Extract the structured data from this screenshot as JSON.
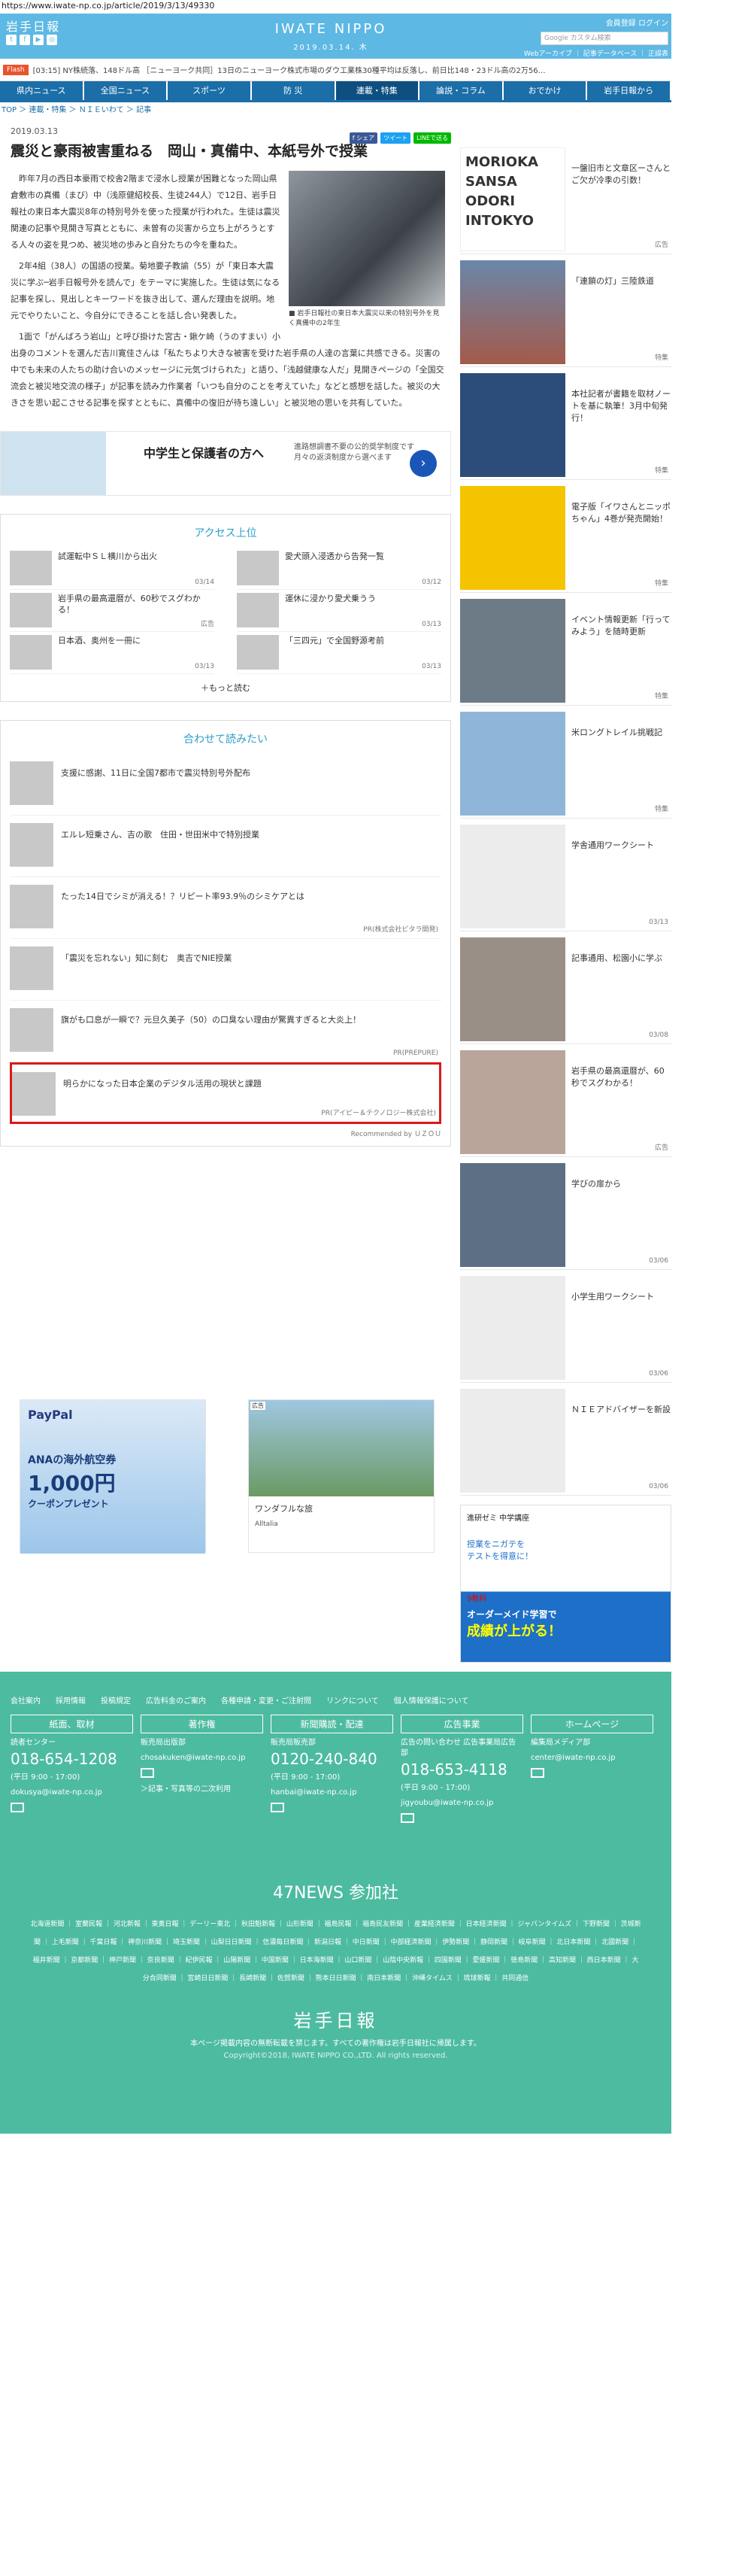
{
  "url": "https://www.iwate-np.co.jp/article/2019/3/13/49330",
  "header": {
    "logo_left": "岩手日報",
    "logo_center": "IWATE NIPPO",
    "date": "2019.03.14. 木",
    "links": "会員登録  ログイン",
    "search_placeholder": "Google カスタム検索",
    "sublinks": "Webアーカイブ ｜ 記事データベース ｜ 正誤表"
  },
  "flash": {
    "label": "Flash",
    "text": "[03:15] NY株続落、148ドル高 ［ニューヨーク共同］13日のニューヨーク株式市場のダウ工業株30種平均は反落し、前日比148・23ドル高の2万56…"
  },
  "nav": [
    "県内ニュース",
    "全国ニュース",
    "スポーツ",
    "防 災",
    "連載・特集",
    "論説・コラム",
    "おでかけ",
    "岩手日報から"
  ],
  "crumb": "TOP ＞ 連載・特集 ＞ ＮＩＥいわて ＞ 記事",
  "article": {
    "date": "2019.03.13",
    "share": [
      "f シェア",
      "ツイート",
      "LINEで送る"
    ],
    "title": "震災と豪雨被害重ねる　岡山・真備中、本紙号外で授業",
    "caption": "■ 岩手日報社の東日本大震災以来の特別号外を見く真備中の2年生",
    "paras": [
      "昨年7月の西日本豪雨で校舎2階まで浸水し授業が困難となった岡山県倉敷市の真備（まび）中（浅原健紹校長、生徒244人）で12日、岩手日報社の東日本大震災8年の特別号外を使った授業が行われた。生徒は震災関連の記事や見開き写真とともに、未曽有の災害から立ち上がろうとする人々の姿を見つめ、被災地の歩みと自分たちの今を重ねた。",
      "2年4組（38人）の国語の授業。菊地要子教諭（55）が「東日本大震災に学ぶ─岩手日報号外を読んで」をテーマに実施した。生徒は気になる記事を探し、見出しとキーワードを抜き出して、選んだ理由を説明。地元でやりたいこと、今自分にできることを話し合い発表した。",
      "1面で「がんばろう岩山」と呼び掛けた宮古・鍬ケ崎（うのすまい）小出身のコメントを選んだ吉川寛佳さんは「私たちより大きな被害を受けた岩手県の人達の言葉に共感できる。災害の中でも未来の人たちの助け合いのメッセージに元気づけられた」と語り、「浅越健康な人だ」見開きページの「全国交流会と被災地交流の様子」が記事を読み力作業者「いつも自分のことを考えていた」などと感想を話した。被災の大きさを思い起こさせる記事を探すとともに、真備中の復旧が待ち遠しい」と被災地の思いを共有していた。"
    ]
  },
  "ad1": {
    "t1": "中学生と保護者の方へ",
    "t2": "進路想調書不要の公的奨学制度です 月々の返済制度から選べます"
  },
  "access": {
    "title": "アクセス上位",
    "items": [
      {
        "t": "試運転中ＳＬ横川から出火",
        "d": "03/14"
      },
      {
        "t": "愛犬頭入浸透から告発一覧",
        "d": "03/12"
      },
      {
        "t": "岩手県の最高還暦が、60秒でスグわかる！",
        "d": "広告"
      },
      {
        "t": "運休に浸かり愛犬乗うう",
        "d": "03/13"
      },
      {
        "t": "日本酒、奥州を一冊に",
        "d": "03/13"
      },
      {
        "t": "「三四元」で全国野源考前",
        "d": "03/13"
      }
    ],
    "more": "＋もっと読む"
  },
  "related": {
    "title": "合わせて読みたい",
    "items": [
      {
        "t": "支援に感謝、11日に全国7都市で震災特別号外配布",
        "pr": ""
      },
      {
        "t": "エルレ短乗さん、吉の歌　住田・世田米中で特別授業",
        "pr": ""
      },
      {
        "t": "たった14日でシミが消える！？リピート率93.9％のシミケアとは",
        "pr": "PR(株式会社ビタラ開発)"
      },
      {
        "t": "「震災を忘れない」知に刻む　奥吉でNIE授業",
        "pr": ""
      },
      {
        "t": "旗がも口息が一瞬で？元旦久美子（50）の口臭ない理由が驚異すぎると大炎上！",
        "pr": "PR(PREPURE)"
      },
      {
        "t": "明らかになった日本企業のデジタル活用の現状と課題",
        "pr": "PR(アイピー＆テクノロジー株式会社)"
      }
    ],
    "recby": "Recommended by ＵＺＯＵ"
  },
  "ads": {
    "paypay": "PayPal",
    "ana": "ANAの海外航空券",
    "amount": "1,000円",
    "coupon": "クーポンプレゼント",
    "ad2_label": "広告",
    "ad2_text": "ワンダフルな旅",
    "ad2_brand": "Alltalia"
  },
  "sidebar": [
    {
      "t": "一盤旧市と文章区ーさんとご欠が冷季の引数！",
      "d": "広告"
    },
    {
      "t": "「連鎖の灯」三陸鉄道",
      "d": "特集"
    },
    {
      "t": "本社記者が書籍を取材ノートを基に執筆！3月中旬発行！",
      "d": "特集"
    },
    {
      "t": "電子版「イワさんとニッポちゃん」4巻が発売開始！",
      "d": "特集"
    },
    {
      "t": "イベント情報更新「行ってみよう」を随時更新",
      "d": "特集"
    },
    {
      "t": "米ロングトレイル挑戦記",
      "d": "特集"
    },
    {
      "t": "学舎通用ワークシート",
      "d": "03/13"
    },
    {
      "t": "記事通用、松園小に学ぶ",
      "d": "03/08"
    },
    {
      "t": "岩手県の最高還暦が、60秒でスグわかる！",
      "d": "広告"
    },
    {
      "t": "学びの扉から",
      "d": "03/06"
    },
    {
      "t": "小学生用ワークシート",
      "d": "03/06"
    },
    {
      "t": "ＮＩＥアドバイザーを新設",
      "d": "03/06"
    }
  ],
  "side_ad": {
    "top": "進研ゼミ 中学講座",
    "l1": "授業をニガテを",
    "l2": "テストを得意に！",
    "l3": "9教科",
    "l4": "オーダーメイド学習で",
    "l5": "成績が上がる！"
  },
  "footer": {
    "links": [
      "会社案内",
      "採用情報",
      "投稿規定",
      "広告料金のご案内",
      "各種申請・変更・ご注射問",
      "リンクについて",
      "個人情報保護について"
    ],
    "cols": [
      {
        "h": "紙面、取材",
        "s": "読者センター",
        "tel": "018-654-1208",
        "hr": "(平日 9:00 - 17:00)",
        "mail": "dokusya@iwate-np.co.jp"
      },
      {
        "h": "著作権",
        "s": "販売局出版部",
        "tel": "",
        "hr": "chosakuken@iwate-np.co.jp",
        "mail": "＞記事・写真等の二次利用"
      },
      {
        "h": "新聞購読・配達",
        "s": "販売局販売部",
        "tel": "0120-240-840",
        "hr": "(平日 9:00 - 17:00)",
        "mail": "hanbai@iwate-np.co.jp"
      },
      {
        "h": "広告事業",
        "s": "広告の問い合わせ 広告事業局広告部",
        "tel": "018-653-4118",
        "hr": "(平日 9:00 - 17:00)",
        "mail": "jigyoubu@iwate-np.co.jp"
      },
      {
        "h": "ホームページ",
        "s": "編集局メディア部",
        "tel": "",
        "hr": "center@iwate-np.co.jp",
        "mail": ""
      }
    ],
    "n47": "47NEWS 参加社",
    "papers": "北海道新聞 ｜ 室蘭民報 ｜ 河北新報 ｜ 東奥日報 ｜ デーリー東北 ｜ 秋田魁新報 ｜ 山形新聞 ｜ 福島民報 ｜ 福島民友新聞 ｜ 産業経済新聞 ｜ 日本経済新聞 ｜ ジャパンタイムズ ｜ 下野新聞 ｜ 茨城新聞 ｜ 上毛新聞 ｜ 千葉日報 ｜ 神奈川新聞 ｜ 埼玉新聞 ｜ 山梨日日新聞 ｜ 信濃毎日新聞 ｜ 新潟日報 ｜ 中日新聞 ｜ 中部経済新聞 ｜ 伊勢新聞 ｜ 静岡新聞 ｜ 岐阜新聞 ｜ 北日本新聞 ｜ 北國新聞 ｜ 福井新聞 ｜ 京都新聞 ｜ 神戸新聞 ｜ 奈良新聞 ｜ 紀伊民報 ｜ 山陽新聞 ｜ 中国新聞 ｜ 日本海新聞 ｜ 山口新聞 ｜ 山陰中央新報 ｜ 四国新聞 ｜ 愛媛新聞 ｜ 徳島新聞 ｜ 高知新聞 ｜ 西日本新聞 ｜ 大分合同新聞 ｜ 宮崎日日新聞 ｜ 長崎新聞 ｜ 佐賀新聞 ｜ 熊本日日新聞 ｜ 南日本新聞 ｜ 沖縄タイムス ｜ 琉球新報 ｜ 共同通信",
    "logo": "岩手日報",
    "copy1": "本ページ掲載内容の無断転載を禁じます。すべての著作権は岩手日報社に帰属します。",
    "copy2": "Copyright©2018, IWATE NIPPO CO.,LTD. All rights reserved."
  }
}
